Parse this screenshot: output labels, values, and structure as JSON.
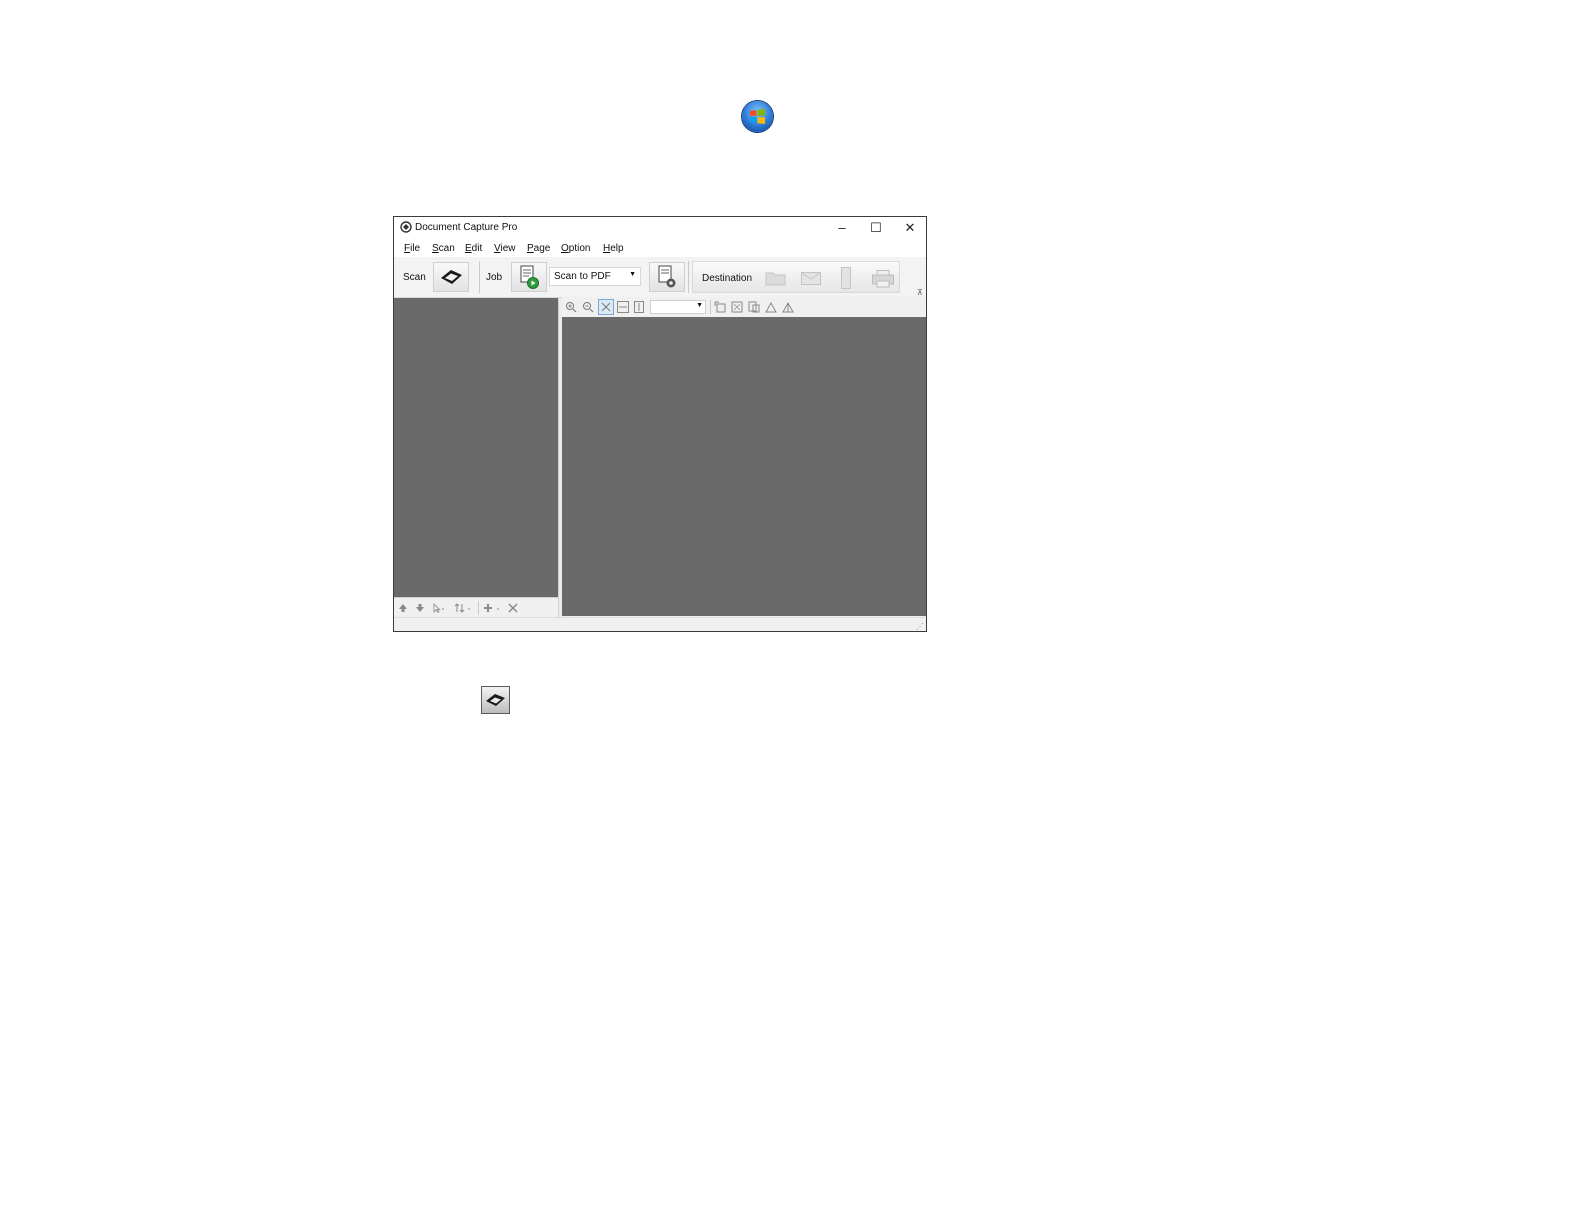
{
  "window": {
    "title": "Document Capture Pro",
    "controls": {
      "minimize": "–",
      "maximize": "☐",
      "close": "✕"
    }
  },
  "menu": [
    {
      "u": "F",
      "rest": "ile"
    },
    {
      "u": "S",
      "rest": "can"
    },
    {
      "u": "E",
      "rest": "dit"
    },
    {
      "u": "V",
      "rest": "iew"
    },
    {
      "u": "P",
      "rest": "age"
    },
    {
      "u": "O",
      "rest": "ption"
    },
    {
      "u": "H",
      "rest": "elp"
    }
  ],
  "toolbar": {
    "scan_label": "Scan",
    "job_label": "Job",
    "job_selected": "Scan to PDF",
    "destination_label": "Destination"
  },
  "icons": {
    "start_orb": "windows-start-icon",
    "scan": "scanner-icon",
    "job_run": "job-run-icon",
    "job_settings": "job-settings-icon",
    "dest_folder": "folder-icon",
    "dest_email": "email-icon",
    "dest_device": "device-icon",
    "dest_print": "printer-icon"
  }
}
